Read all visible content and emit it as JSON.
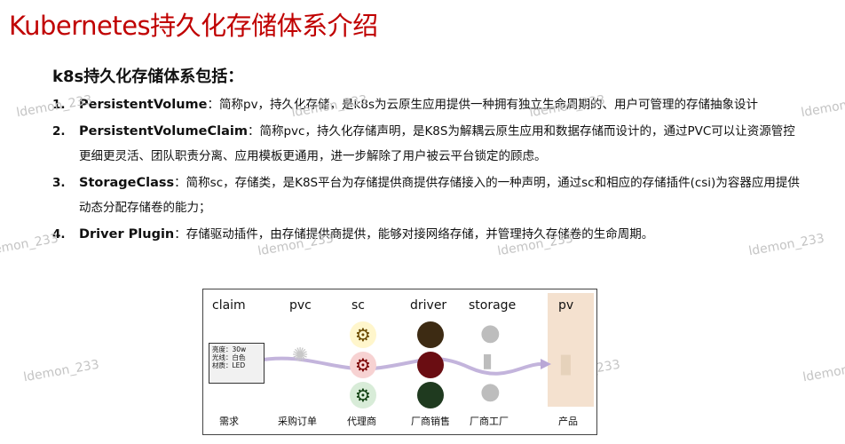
{
  "title": "Kubernetes持久化存储体系介绍",
  "subtitle": "k8s持久化存储体系包括：",
  "items": [
    {
      "num": "1.",
      "term": "PersistentVolume",
      "text": "：简称pv，持久化存储，是k8s为云原生应用提供一种拥有独立生命周期的、用户可管理的存储抽象设计"
    },
    {
      "num": "2.",
      "term": "PersistentVolumeClaim",
      "text": "：简称pvc，持久化存储声明，是K8S为解耦云原生应用和数据存储而设计的，通过PVC可以让资源管控更细更灵活、团队职责分离、应用模板更通用，进一步解除了用户被云平台锁定的顾虑。"
    },
    {
      "num": "3.",
      "term": "StorageClass",
      "text": "：简称sc，存储类，是K8S平台为存储提供商提供存储接入的一种声明，通过sc和相应的存储插件(csi)为容器应用提供动态分配存储卷的能力；"
    },
    {
      "num": "4.",
      "term": "Driver Plugin",
      "text": "：存储驱动插件，由存储提供商提供，能够对接网络存储，并管理持久存储卷的生命周期。"
    }
  ],
  "watermark": "ldemon_233",
  "diagram": {
    "headers": [
      "claim",
      "pvc",
      "sc",
      "driver",
      "storage",
      "pv"
    ],
    "footers": [
      "需求",
      "采购订单",
      "代理商",
      "厂商销售",
      "厂商工厂",
      "产品"
    ],
    "note_lines": [
      "亮度：30w",
      "光线：白色",
      "材质：LED"
    ],
    "icons": {
      "gear": "gear-icon",
      "basket": "basket-icon",
      "bulb": "light-bulb-icon"
    },
    "colors": {
      "gear_bg": [
        "#fff6cc",
        "#f7d2d2",
        "#d8ecd8"
      ],
      "pv_bg": "#f4e1cf",
      "arrow": "#b9a7d6"
    }
  }
}
